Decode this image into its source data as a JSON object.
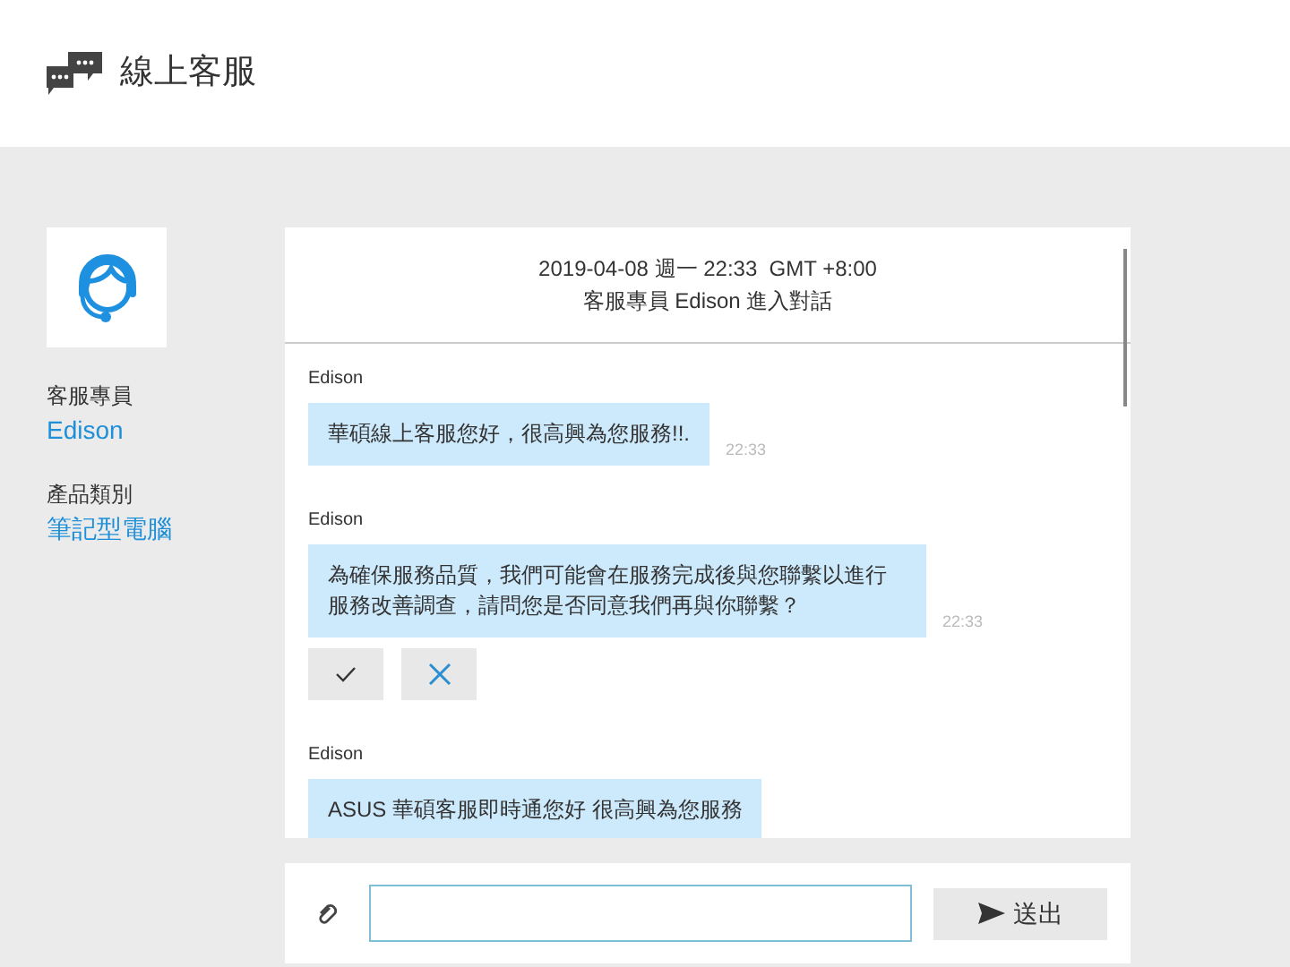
{
  "header": {
    "title": "線上客服"
  },
  "agent": {
    "role_label": "客服專員",
    "name": "Edison",
    "category_label": "產品類別",
    "category": "筆記型電腦"
  },
  "chat": {
    "date": "2019-04-08 週一 22:33  GMT +8:00",
    "notice": "客服專員 Edison 進入對話",
    "messages": [
      {
        "sender": "Edison",
        "text": "華碩線上客服您好，很高興為您服務!!.",
        "time": "22:33"
      },
      {
        "sender": "Edison",
        "text": "為確保服務品質，我們可能會在服務完成後與您聯繫以進行服務改善調查，請問您是否同意我們再與你聯繫？",
        "time": "22:33",
        "choices": [
          {
            "kind": "yes"
          },
          {
            "kind": "no"
          }
        ]
      },
      {
        "sender": "Edison",
        "text": "ASUS 華碩客服即時通您好 很高興為您服務"
      }
    ]
  },
  "composer": {
    "send_label": "送出"
  }
}
